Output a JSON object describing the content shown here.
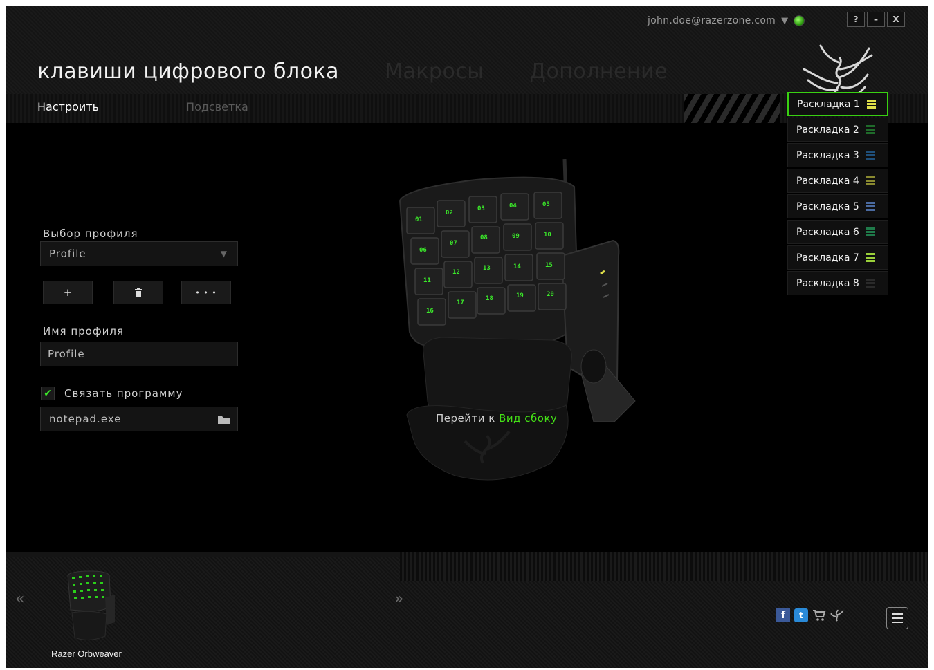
{
  "header": {
    "email": "john.doe@razerzone.com",
    "window_buttons": {
      "help": "?",
      "minimize": "–",
      "close": "X"
    }
  },
  "main_tabs": [
    {
      "label": "клавиши цифрового блока",
      "active": true
    },
    {
      "label": "Макросы",
      "active": false
    },
    {
      "label": "Дополнение",
      "active": false
    }
  ],
  "sub_tabs": [
    {
      "label": "Настроить",
      "active": true
    },
    {
      "label": "Подсветка",
      "active": false
    }
  ],
  "profile": {
    "select_label": "Выбор профиля",
    "selected": "Profile",
    "add": "+",
    "delete_icon": "trash-icon",
    "more": "• • •",
    "name_label": "Имя профиля",
    "name_value": "Profile",
    "link_label": "Связать программу",
    "link_checked": true,
    "program": "notepad.exe"
  },
  "layouts": [
    {
      "label": "Раскладка 1",
      "color": "#e0e04a",
      "active": true
    },
    {
      "label": "Раскладка 2",
      "color": "#1f6b2a",
      "active": false
    },
    {
      "label": "Раскладка 3",
      "color": "#1f4f7a",
      "active": false
    },
    {
      "label": "Раскладка 4",
      "color": "#8a8a30",
      "active": false
    },
    {
      "label": "Раскладка 5",
      "color": "#4a6aa0",
      "active": false
    },
    {
      "label": "Раскладка 6",
      "color": "#1f7a4a",
      "active": false
    },
    {
      "label": "Раскладка 7",
      "color": "#9ad03a",
      "active": false
    },
    {
      "label": "Раскладка 8",
      "color": "#2a2a2a",
      "active": false
    }
  ],
  "device_keys": [
    "01",
    "02",
    "03",
    "04",
    "05",
    "06",
    "07",
    "08",
    "09",
    "10",
    "11",
    "12",
    "13",
    "14",
    "15",
    "16",
    "17",
    "18",
    "19",
    "20"
  ],
  "goto": {
    "prefix": "Перейти к",
    "link": "Вид сбоку"
  },
  "footer": {
    "device_name": "Razer Orbweaver",
    "prev": "«",
    "next": "»"
  },
  "colors": {
    "accent": "#44e016",
    "background": "#000000"
  }
}
